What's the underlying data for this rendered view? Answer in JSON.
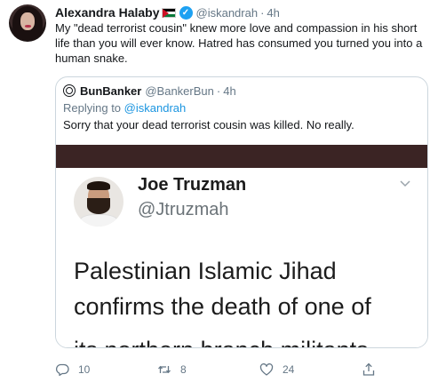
{
  "tweet": {
    "author_name": "Alexandra Halaby",
    "author_handle": "@iskandrah",
    "dot": "·",
    "time": "4h",
    "text": "My \"dead terrorist cousin\" knew more love and compassion in his short life than you will ever know. Hatred has consumed you turned you into a human snake."
  },
  "quote": {
    "author_name": "BunBanker",
    "author_handle": "@BankerBun",
    "dot": "·",
    "time": "4h",
    "replying_prefix": "Replying to",
    "replying_to": "@iskandrah",
    "text": "Sorry that your dead terrorist cousin was killed.  No really."
  },
  "screenshot": {
    "name": "Joe Truzman",
    "handle": "@Jtruzmah",
    "line1": "Palestinian Islamic Jihad",
    "line2": "confirms the death of one of",
    "line3": "its northern branch militants"
  },
  "actions": {
    "reply_count": "10",
    "retweet_count": "8",
    "like_count": "24"
  },
  "icons": {
    "verified": "verified-badge-icon",
    "flag": "palestinian-flag-icon",
    "reply": "reply-icon",
    "retweet": "retweet-icon",
    "like": "heart-icon",
    "share": "share-icon",
    "chevron": "chevron-down-icon"
  },
  "colors": {
    "link": "#1b95e0",
    "verified": "#1da1f2",
    "muted": "#657786",
    "dark_bar": "#3b2424"
  }
}
